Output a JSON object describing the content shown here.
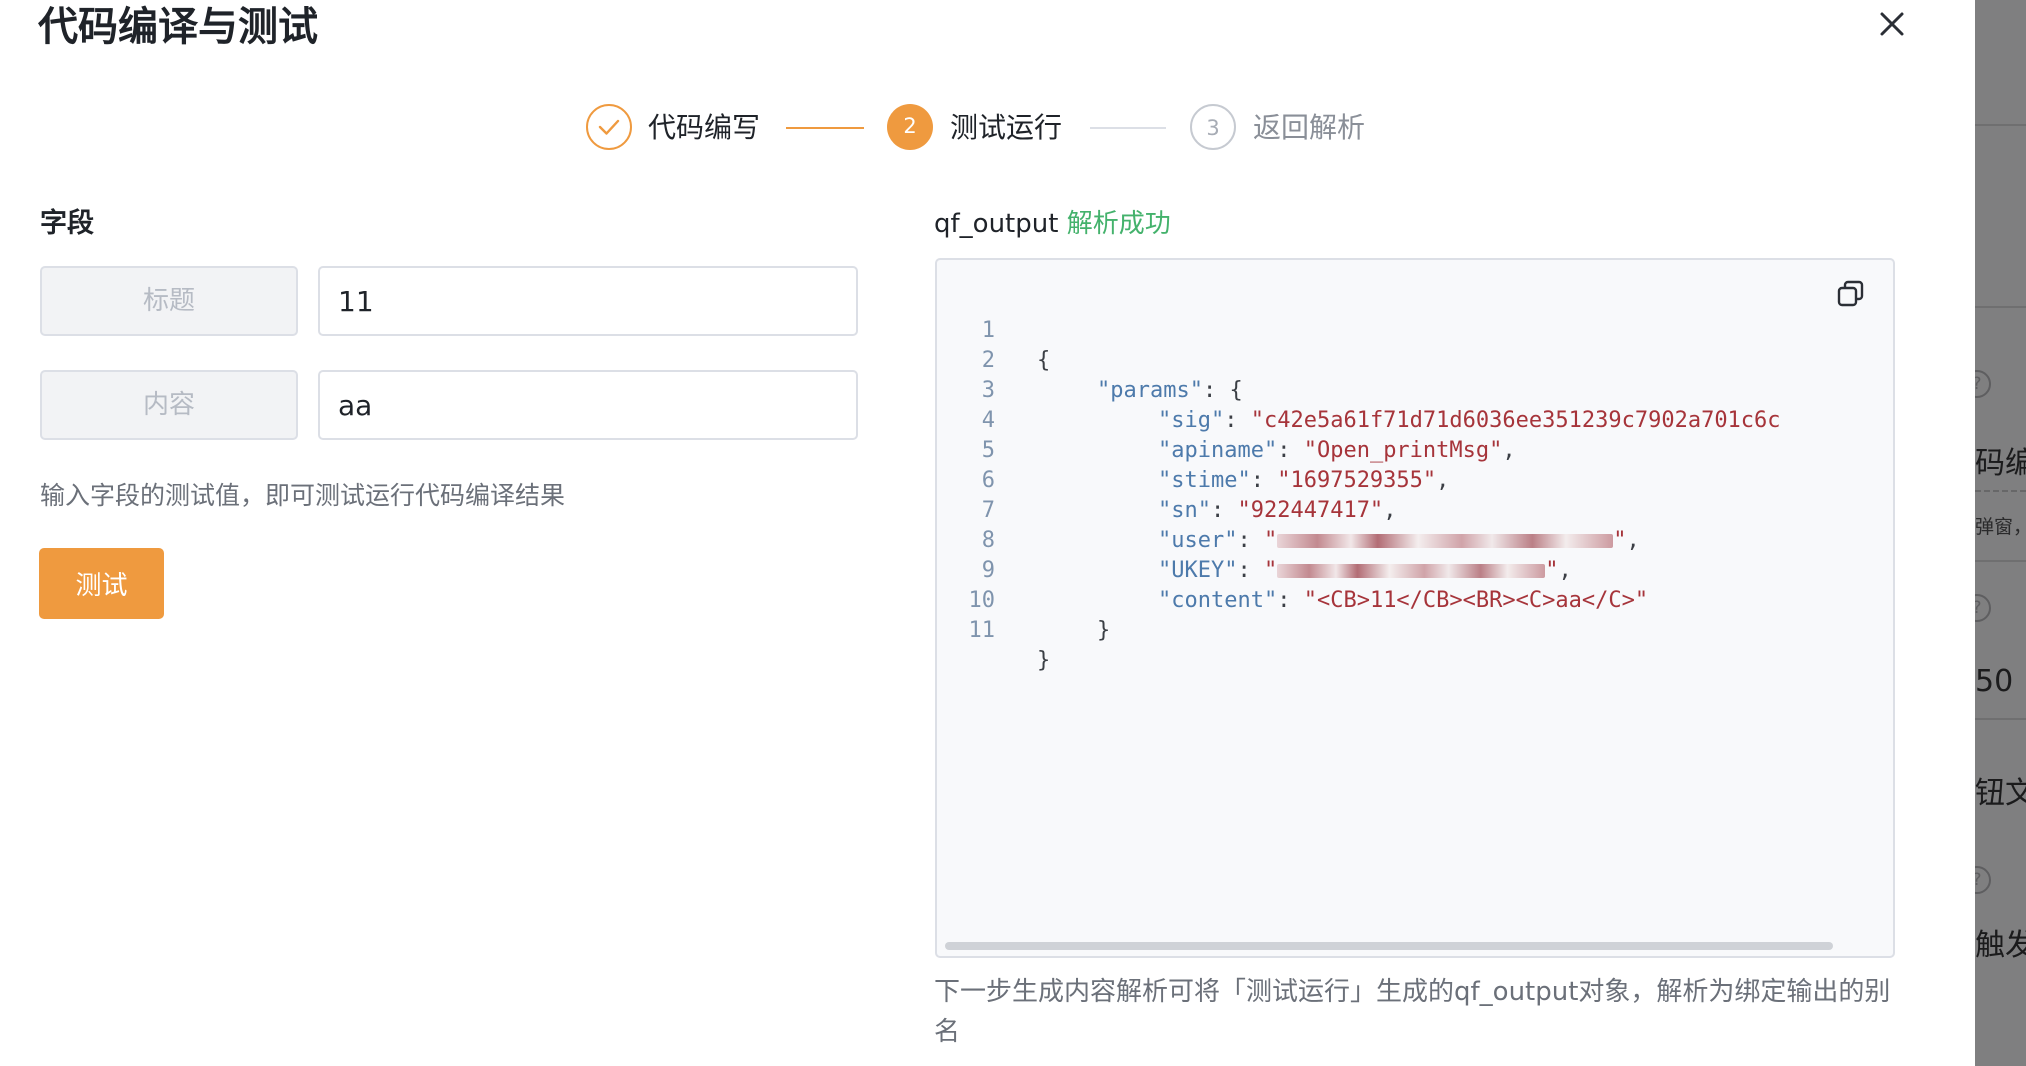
{
  "dialog": {
    "title": "代码编译与测试"
  },
  "steps": [
    {
      "label": "代码编写",
      "status": "done"
    },
    {
      "number": "2",
      "label": "测试运行",
      "status": "active"
    },
    {
      "number": "3",
      "label": "返回解析",
      "status": "pending"
    }
  ],
  "fields": {
    "section_title": "字段",
    "rows": [
      {
        "label": "标题",
        "value": "11"
      },
      {
        "label": "内容",
        "value": "aa"
      }
    ],
    "hint": "输入字段的测试值，即可测试运行代码编译结果",
    "test_button": "测试"
  },
  "output": {
    "name": "qf_output",
    "status": "解析成功",
    "lines": [
      {
        "no": "1",
        "text": "{"
      },
      {
        "no": "2",
        "key": "\"params\"",
        "rest": ": {"
      },
      {
        "no": "3",
        "key": "\"sig\"",
        "value": "\"c42e5a61f71d71d6036ee351239c7902a701c6c"
      },
      {
        "no": "4",
        "key": "\"apiname\"",
        "value": "\"Open_printMsg\"",
        "tail": ","
      },
      {
        "no": "5",
        "key": "\"stime\"",
        "value": "\"1697529355\"",
        "tail": ","
      },
      {
        "no": "6",
        "key": "\"sn\"",
        "value": "\"922447417\"",
        "tail": ","
      },
      {
        "no": "7",
        "key": "\"user\"",
        "value_open": "\"",
        "value_close": "\"",
        "tail": ","
      },
      {
        "no": "8",
        "key": "\"UKEY\"",
        "value_open": "\"",
        "value_close": "\"",
        "tail": ","
      },
      {
        "no": "9",
        "key": "\"content\"",
        "value": "\"<CB>11</CB><BR><C>aa</C>\""
      },
      {
        "no": "10",
        "text": "}"
      },
      {
        "no": "11",
        "text": "}"
      }
    ],
    "note": "下一步生成内容解析可将「测试运行」生成的qf_output对象，解析为绑定输出的别名"
  },
  "background_panel": {
    "fragments": [
      "码编",
      "弹窗，",
      "50",
      "钮文",
      "触发"
    ]
  },
  "colors": {
    "accent": "#ef9a3f",
    "success": "#44b26c",
    "json_key": "#4d7aab",
    "json_string": "#a6343a"
  }
}
